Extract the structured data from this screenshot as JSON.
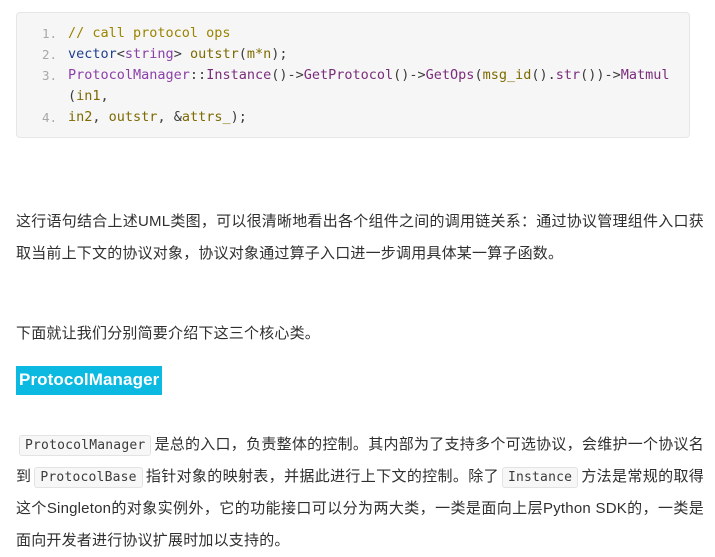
{
  "code_block": {
    "language": "cpp",
    "background": "#f6f6f6",
    "lines": [
      {
        "number": "1",
        "tokens": [
          {
            "text": "// call protocol ops",
            "cls": "t-com"
          }
        ]
      },
      {
        "number": "2",
        "tokens": [
          {
            "text": "vector",
            "cls": "t-kw"
          },
          {
            "text": "<",
            "cls": "t-pun"
          },
          {
            "text": "string",
            "cls": "t-typ"
          },
          {
            "text": "> ",
            "cls": "t-pun"
          },
          {
            "text": "outstr",
            "cls": "t-id"
          },
          {
            "text": "(",
            "cls": "t-pun"
          },
          {
            "text": "m*n",
            "cls": "t-id"
          },
          {
            "text": ");",
            "cls": "t-pun"
          }
        ]
      },
      {
        "number": "3",
        "tokens": [
          {
            "text": "ProtocolManager",
            "cls": "t-cls"
          },
          {
            "text": "::",
            "cls": "t-pun"
          },
          {
            "text": "Instance",
            "cls": "t-fn"
          },
          {
            "text": "()->",
            "cls": "t-pun"
          },
          {
            "text": "GetProtocol",
            "cls": "t-fn"
          },
          {
            "text": "()->",
            "cls": "t-pun"
          },
          {
            "text": "GetOps",
            "cls": "t-fn"
          },
          {
            "text": "(",
            "cls": "t-pun"
          },
          {
            "text": "msg_id",
            "cls": "t-id"
          },
          {
            "text": "().",
            "cls": "t-pun"
          },
          {
            "text": "str",
            "cls": "t-fn"
          },
          {
            "text": "())->",
            "cls": "t-pun"
          },
          {
            "text": "Matmul",
            "cls": "t-fn"
          },
          {
            "text": "(",
            "cls": "t-pun"
          },
          {
            "text": "in1",
            "cls": "t-id"
          },
          {
            "text": ",",
            "cls": "t-pun"
          }
        ]
      },
      {
        "number": "4",
        "tokens": [
          {
            "text": "in2",
            "cls": "t-id"
          },
          {
            "text": ", ",
            "cls": "t-pun"
          },
          {
            "text": "outstr",
            "cls": "t-id"
          },
          {
            "text": ", &",
            "cls": "t-pun"
          },
          {
            "text": "attrs_",
            "cls": "t-id"
          },
          {
            "text": ");",
            "cls": "t-pun"
          }
        ]
      }
    ]
  },
  "paragraphs": {
    "p1": "这行语句结合上述UML类图，可以很清晰地看出各个组件之间的调用链关系：通过协议管理组件入口获取当前上下文的协议对象，协议对象通过算子入口进一步调用具体某一算子函数。",
    "p2": "下面就让我们分别简要介绍下这三个核心类。"
  },
  "heading": {
    "text": "ProtocolManager",
    "highlight_color": "#0cb9e0",
    "text_color": "#ffffff"
  },
  "paragraph3": {
    "chip1": "ProtocolManager",
    "seg1": "是总的入口，负责整体的控制。其内部为了支持多个可选协议，会维护一个协议名到",
    "chip2": "ProtocolBase",
    "seg2": "指针对象的映射表，并据此进行上下文的控制。除了",
    "chip3": "Instance",
    "seg3": "方法是常规的取得这个Singleton的对象实例外，它的功能接口可以分为两大类，一类是面向上层Python SDK的，一类是面向开发者进行协议扩展时加以支持的。"
  }
}
